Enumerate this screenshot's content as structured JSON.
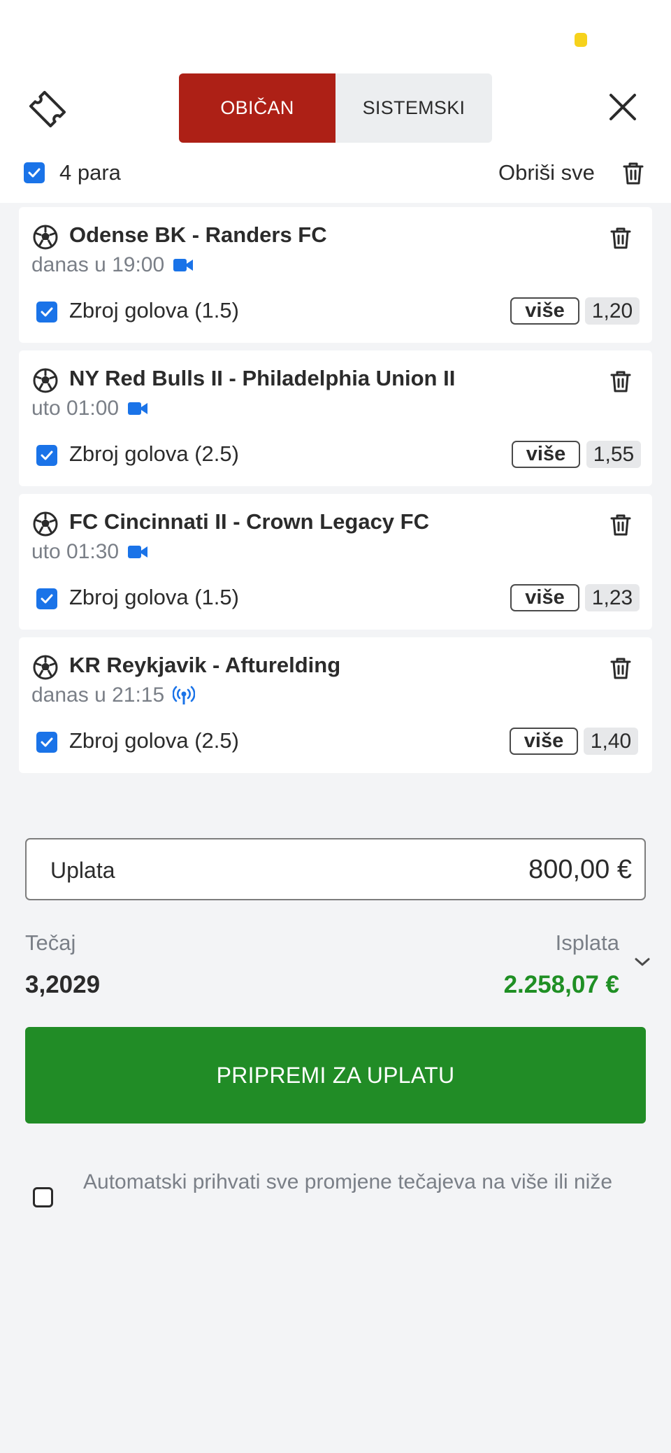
{
  "header": {
    "tabs": [
      {
        "label": "OBIČAN",
        "active": true
      },
      {
        "label": "SISTEMSKI",
        "active": false
      }
    ],
    "select_all_label": "4 para",
    "select_all_checked": true,
    "delete_all_label": "Obriši sve"
  },
  "bets": [
    {
      "match": "Odense BK - Randers FC",
      "time": "danas u 19:00",
      "stream": "video-icon",
      "market": "Zbroj golova (1.5)",
      "pick": "više",
      "odd": "1,20"
    },
    {
      "match": "NY Red Bulls II - Philadelphia Union II",
      "time": "uto 01:00",
      "stream": "video-icon",
      "market": "Zbroj golova (2.5)",
      "pick": "više",
      "odd": "1,55"
    },
    {
      "match": "FC Cincinnati II - Crown Legacy FC",
      "time": "uto 01:30",
      "stream": "video-icon",
      "market": "Zbroj golova (1.5)",
      "pick": "više",
      "odd": "1,23"
    },
    {
      "match": "KR Reykjavik - Afturelding",
      "time": "danas u 21:15",
      "stream": "live-signal-icon",
      "market": "Zbroj golova (2.5)",
      "pick": "više",
      "odd": "1,40"
    }
  ],
  "stake": {
    "label": "Uplata",
    "value": "800,00 €"
  },
  "summary": {
    "odds_label": "Tečaj",
    "odds_value": "3,2029",
    "payout_label": "Isplata",
    "payout_value": "2.258,07 €"
  },
  "submit_label": "PRIPREMI ZA UPLATU",
  "auto_accept": {
    "label": "Automatski prihvati sve promjene tečajeva na više ili niže",
    "checked": false
  },
  "colors": {
    "brand_red": "#ad2016",
    "accent_blue": "#1a73e8",
    "payout_green": "#1f8f24",
    "button_green": "#218c26",
    "status_yellow": "#f6d21c"
  }
}
